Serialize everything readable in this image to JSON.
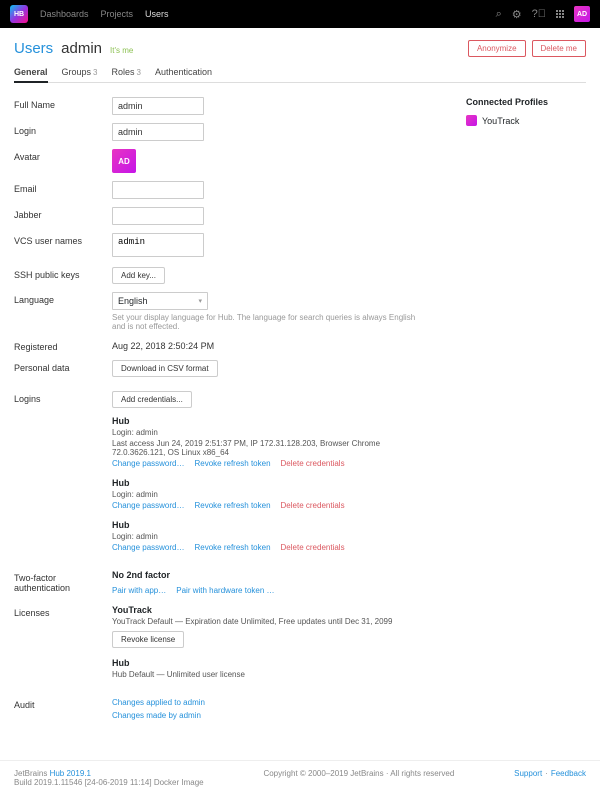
{
  "header": {
    "logo_text": "HB",
    "nav": [
      "Dashboards",
      "Projects",
      "Users"
    ],
    "active_nav": "Users",
    "avatar_text": "AD"
  },
  "breadcrumb": "Users",
  "page_title": "admin",
  "its_me": "It's me",
  "actions": {
    "anonymize": "Anonymize",
    "delete": "Delete me"
  },
  "tabs": [
    {
      "label": "General",
      "count": null,
      "active": true
    },
    {
      "label": "Groups",
      "count": "3",
      "active": false
    },
    {
      "label": "Roles",
      "count": "3",
      "active": false
    },
    {
      "label": "Authentication",
      "count": null,
      "active": false
    }
  ],
  "form": {
    "full_name": {
      "label": "Full Name",
      "value": "admin"
    },
    "login": {
      "label": "Login",
      "value": "admin"
    },
    "avatar": {
      "label": "Avatar",
      "text": "AD"
    },
    "email": {
      "label": "Email",
      "value": ""
    },
    "jabber": {
      "label": "Jabber",
      "value": ""
    },
    "vcs": {
      "label": "VCS user names",
      "value": "admin"
    },
    "ssh": {
      "label": "SSH public keys",
      "button": "Add key..."
    },
    "language": {
      "label": "Language",
      "value": "English",
      "help": "Set your display language for Hub. The language for search queries is always English and is not effected."
    },
    "registered": {
      "label": "Registered",
      "value": "Aug 22, 2018 2:50:24 PM"
    },
    "personal_data": {
      "label": "Personal data",
      "button": "Download in CSV format"
    }
  },
  "logins": {
    "label": "Logins",
    "add_button": "Add credentials...",
    "items": [
      {
        "title": "Hub",
        "login_line": "Login: admin",
        "detail": "Last access Jun 24, 2019 2:51:37 PM, IP 172.31.128.203, Browser Chrome 72.0.3626.121, OS Linux x86_64",
        "change": "Change password…",
        "revoke": "Revoke refresh token",
        "delete": "Delete credentials"
      },
      {
        "title": "Hub",
        "login_line": "Login: admin",
        "detail": "",
        "change": "Change password…",
        "revoke": "Revoke refresh token",
        "delete": "Delete credentials"
      },
      {
        "title": "Hub",
        "login_line": "Login: admin",
        "detail": "",
        "change": "Change password…",
        "revoke": "Revoke refresh token",
        "delete": "Delete credentials"
      }
    ]
  },
  "two_factor": {
    "label": "Two-factor authentication",
    "status": "No 2nd factor",
    "pair_app": "Pair with app…",
    "pair_hw": "Pair with hardware token …"
  },
  "licenses": {
    "label": "Licenses",
    "items": [
      {
        "title": "YouTrack",
        "detail": "YouTrack Default — Expiration date Unlimited, Free updates until Dec 31, 2099",
        "revoke": "Revoke license"
      },
      {
        "title": "Hub",
        "detail": "Hub Default — Unlimited user license",
        "revoke": null
      }
    ]
  },
  "audit": {
    "label": "Audit",
    "applied": "Changes applied to admin",
    "made": "Changes made by admin"
  },
  "side": {
    "heading": "Connected Profiles",
    "item": "YouTrack"
  },
  "footer": {
    "company": "JetBrains ",
    "product": "Hub 2019.1",
    "build": "Build 2019.1.11546 [24-06-2019 11:14] Docker Image",
    "copyright": "Copyright © 2000–2019 JetBrains · All rights reserved",
    "support": "Support",
    "feedback": "Feedback"
  }
}
